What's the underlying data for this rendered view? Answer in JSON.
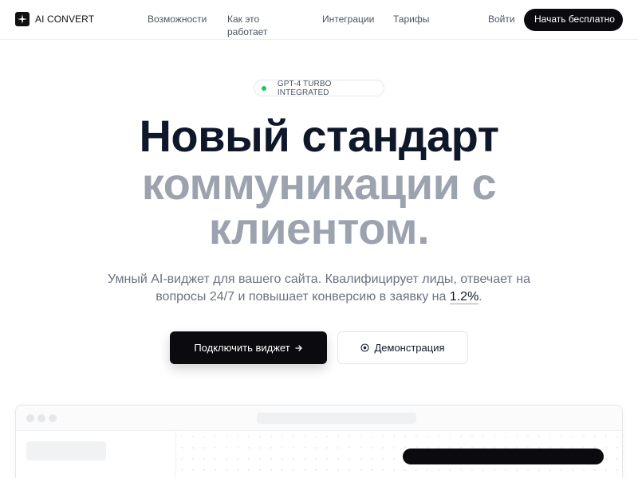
{
  "brand": {
    "name": "AI CONVERT"
  },
  "nav": {
    "features": "Возможности",
    "how_it_works": "Как это работает",
    "integrations": "Интеграции",
    "pricing": "Тарифы",
    "login": "Войти",
    "cta": "Начать бесплатно"
  },
  "hero": {
    "badge": "GPT-4 TURBO INTEGRATED",
    "headline_line1": "Новый стандарт",
    "headline_line2": "коммуникации с",
    "headline_line3": "клиентом.",
    "subtext_before": "Умный AI-виджет для вашего сайта. Квалифицирует лиды, отвечает на вопросы 24/7 и повышает конверсию в заявку на ",
    "subtext_highlight": "1.2%",
    "subtext_after": ".",
    "primary_button": "Подключить виджет",
    "secondary_button": "Демонстрация"
  },
  "colors": {
    "accent": "#0b0b0f",
    "headline_dark": "#0f172a",
    "headline_muted": "#9ca3af",
    "badge_dot": "#22c55e"
  },
  "icons": {
    "logo": "sparkle-icon",
    "primary_button": "arrow-right-icon",
    "secondary_button": "target-icon"
  }
}
